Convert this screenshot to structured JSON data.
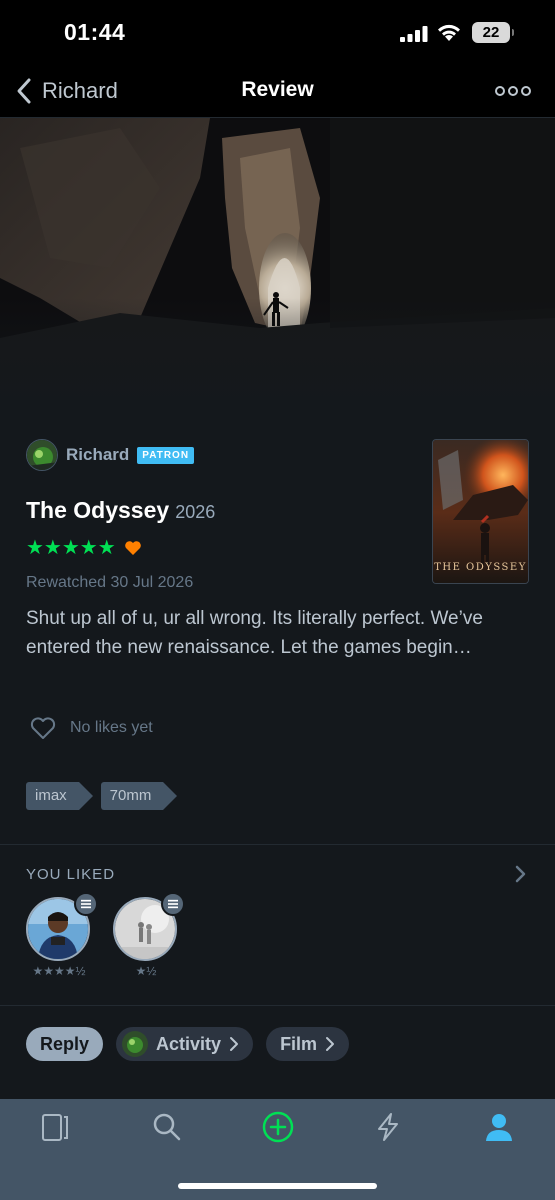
{
  "status_bar": {
    "time": "01:44",
    "battery": "22"
  },
  "nav": {
    "back_label": "Richard",
    "title": "Review"
  },
  "review": {
    "author": "Richard",
    "badge": "PATRON",
    "film_title": "The Odyssey",
    "film_year": "2026",
    "stars": "★★★★★",
    "liked_icon": "heart-icon",
    "watch_info": "Rewatched 30 Jul 2026",
    "text": "Shut up all of u, ur all wrong. Its literally perfect. We’ve entered the new renaissance. Let the games begin…",
    "likes_text": "No likes yet",
    "poster_title": "THE ODYSSEY",
    "tags": [
      "imax",
      "70mm"
    ]
  },
  "you_liked": {
    "label": "YOU LIKED",
    "items": [
      {
        "rating": "★★★★½"
      },
      {
        "rating": "★½"
      }
    ]
  },
  "actions": {
    "reply": "Reply",
    "activity": "Activity",
    "film": "Film"
  },
  "colors": {
    "accent_green": "#00e054",
    "accent_orange": "#ff8000",
    "patron_blue": "#40bcf4",
    "tab_active": "#40bcf4"
  }
}
